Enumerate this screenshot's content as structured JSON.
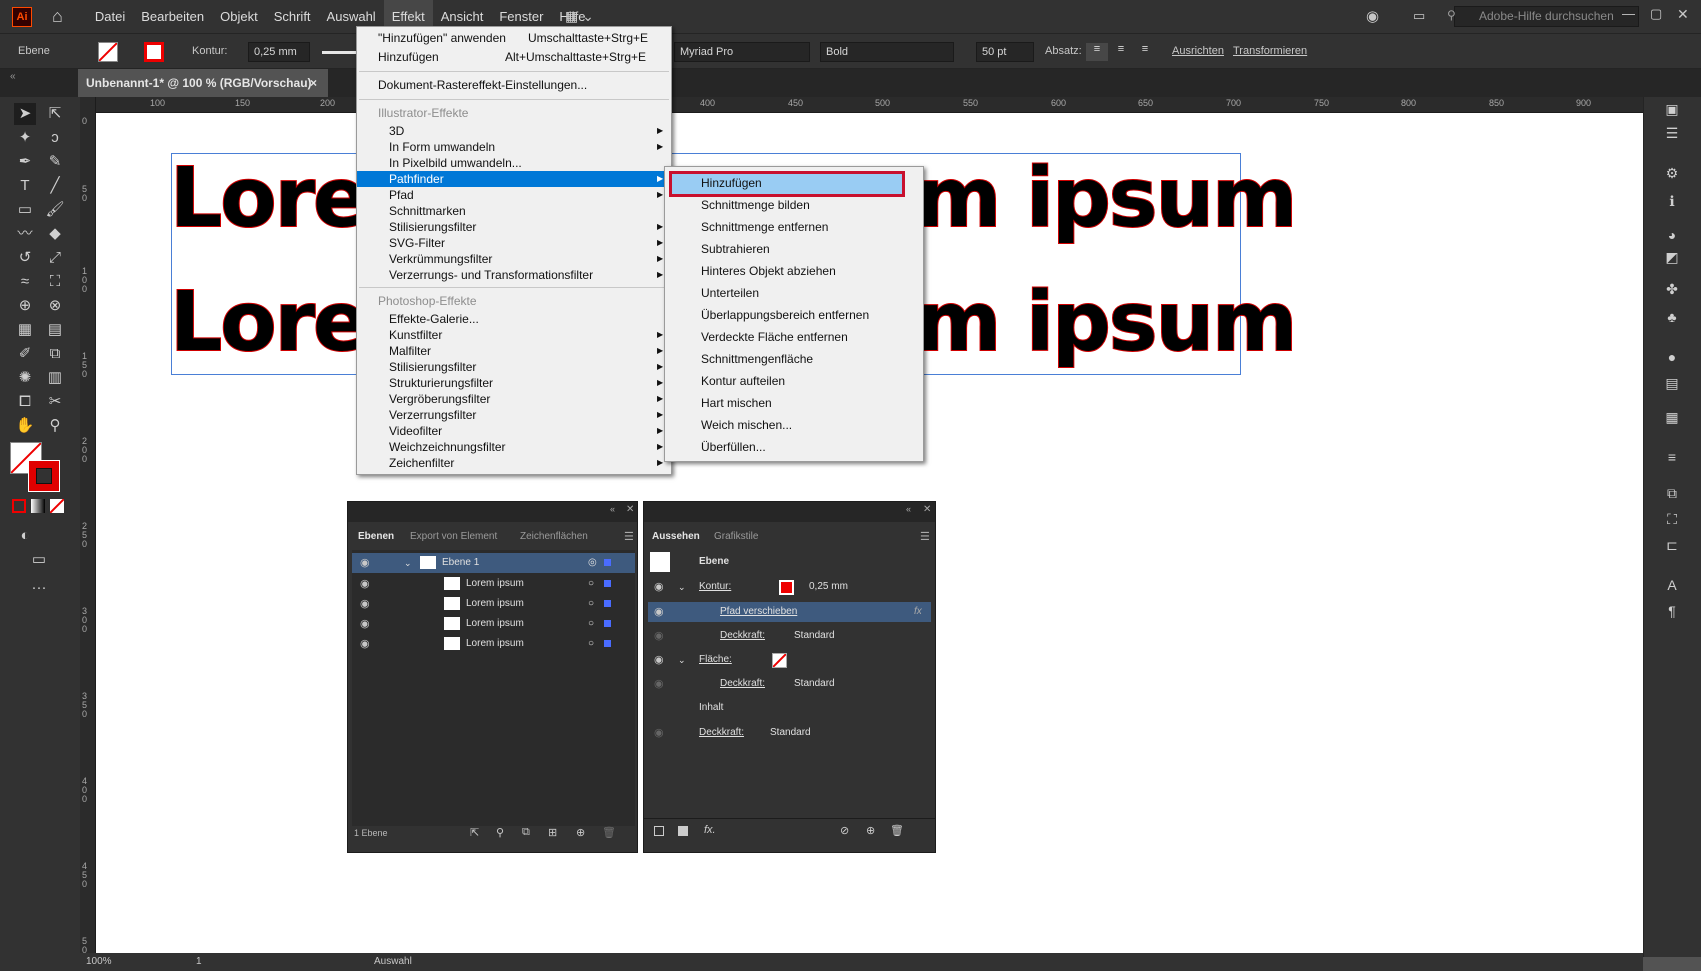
{
  "app": {
    "logo": "Ai"
  },
  "menubar": {
    "items": [
      "Datei",
      "Bearbeiten",
      "Objekt",
      "Schrift",
      "Auswahl",
      "Effekt",
      "Ansicht",
      "Fenster",
      "Hilfe"
    ],
    "active": "Effekt",
    "search_placeholder": "Adobe-Hilfe durchsuchen"
  },
  "controlbar": {
    "object_label": "Ebene",
    "kontur_label": "Kontur:",
    "stroke_width": "0,25 mm",
    "font_family": "Myriad Pro",
    "font_style": "Bold",
    "font_size": "50 pt",
    "absatz_label": "Absatz:",
    "ausrichten": "Ausrichten",
    "transformieren": "Transformieren"
  },
  "document_tab": {
    "title": "Unbenannt-1* @ 100 % (RGB/Vorschau)",
    "close": "×"
  },
  "ruler": {
    "h_ticks": [
      "100",
      "150",
      "200",
      "400",
      "450",
      "500",
      "550",
      "600",
      "650",
      "700",
      "750",
      "800",
      "850",
      "900"
    ],
    "v_ticks": [
      "0",
      "50",
      "100",
      "150",
      "200",
      "250",
      "300",
      "350",
      "400",
      "450",
      "500"
    ]
  },
  "canvas": {
    "line1_left": "Lorem",
    "line1_right": "m ipsum",
    "line2_left": "Lorem",
    "line2_right": "m ipsum"
  },
  "effekt_menu": {
    "items": [
      {
        "label": "\"Hinzufügen\" anwenden",
        "shortcut": "Umschalttaste+Strg+E"
      },
      {
        "label": "Hinzufügen",
        "shortcut": "Alt+Umschalttaste+Strg+E"
      },
      {
        "label": "Dokument-Rastereffekt-Einstellungen..."
      },
      {
        "label": "Illustrator-Effekte",
        "header": true
      },
      {
        "label": "3D",
        "submenu": true
      },
      {
        "label": "In Form umwandeln",
        "submenu": true
      },
      {
        "label": "In Pixelbild umwandeln..."
      },
      {
        "label": "Pathfinder",
        "submenu": true,
        "highlighted": true
      },
      {
        "label": "Pfad",
        "submenu": true
      },
      {
        "label": "Schnittmarken"
      },
      {
        "label": "Stilisierungsfilter",
        "submenu": true
      },
      {
        "label": "SVG-Filter",
        "submenu": true
      },
      {
        "label": "Verkrümmungsfilter",
        "submenu": true
      },
      {
        "label": "Verzerrungs- und Transformationsfilter",
        "submenu": true
      },
      {
        "label": "Photoshop-Effekte",
        "header": true
      },
      {
        "label": "Effekte-Galerie..."
      },
      {
        "label": "Kunstfilter",
        "submenu": true
      },
      {
        "label": "Malfilter",
        "submenu": true
      },
      {
        "label": "Stilisierungsfilter",
        "submenu": true
      },
      {
        "label": "Strukturierungsfilter",
        "submenu": true
      },
      {
        "label": "Vergröberungsfilter",
        "submenu": true
      },
      {
        "label": "Verzerrungsfilter",
        "submenu": true
      },
      {
        "label": "Videofilter",
        "submenu": true
      },
      {
        "label": "Weichzeichnungsfilter",
        "submenu": true
      },
      {
        "label": "Zeichenfilter",
        "submenu": true
      }
    ]
  },
  "pathfinder_submenu": {
    "items": [
      "Hinzufügen",
      "Schnittmenge bilden",
      "Schnittmenge entfernen",
      "Subtrahieren",
      "Hinteres Objekt abziehen",
      "Unterteilen",
      "Überlappungsbereich entfernen",
      "Verdeckte Fläche entfernen",
      "Schnittmengenfläche",
      "Kontur aufteilen",
      "Hart mischen",
      "Weich mischen...",
      "Überfüllen..."
    ],
    "highlighted": "Hinzufügen"
  },
  "layers_panel": {
    "tabs": [
      "Ebenen",
      "Export von Element",
      "Zeichenflächen"
    ],
    "layer": "Ebene 1",
    "sublayers": [
      "Lorem ipsum",
      "Lorem ipsum",
      "Lorem ipsum",
      "Lorem ipsum"
    ],
    "footer": "1 Ebene"
  },
  "appearance_panel": {
    "tabs": [
      "Aussehen",
      "Grafikstile"
    ],
    "target": "Ebene",
    "kontur_label": "Kontur:",
    "kontur_value": "0,25 mm",
    "effect": "Pfad verschieben",
    "fx": "fx",
    "deckkraft_label": "Deckkraft:",
    "deckkraft_value": "Standard",
    "flaeche_label": "Fläche:",
    "inhalt": "Inhalt",
    "footer_fx": "fx."
  },
  "statusbar": {
    "zoom": "100%",
    "page": "1",
    "mode": "Auswahl"
  },
  "colors": {
    "accent": "#0078d7",
    "highlight_box": "#c8102e",
    "stroke_red": "#d00000"
  }
}
